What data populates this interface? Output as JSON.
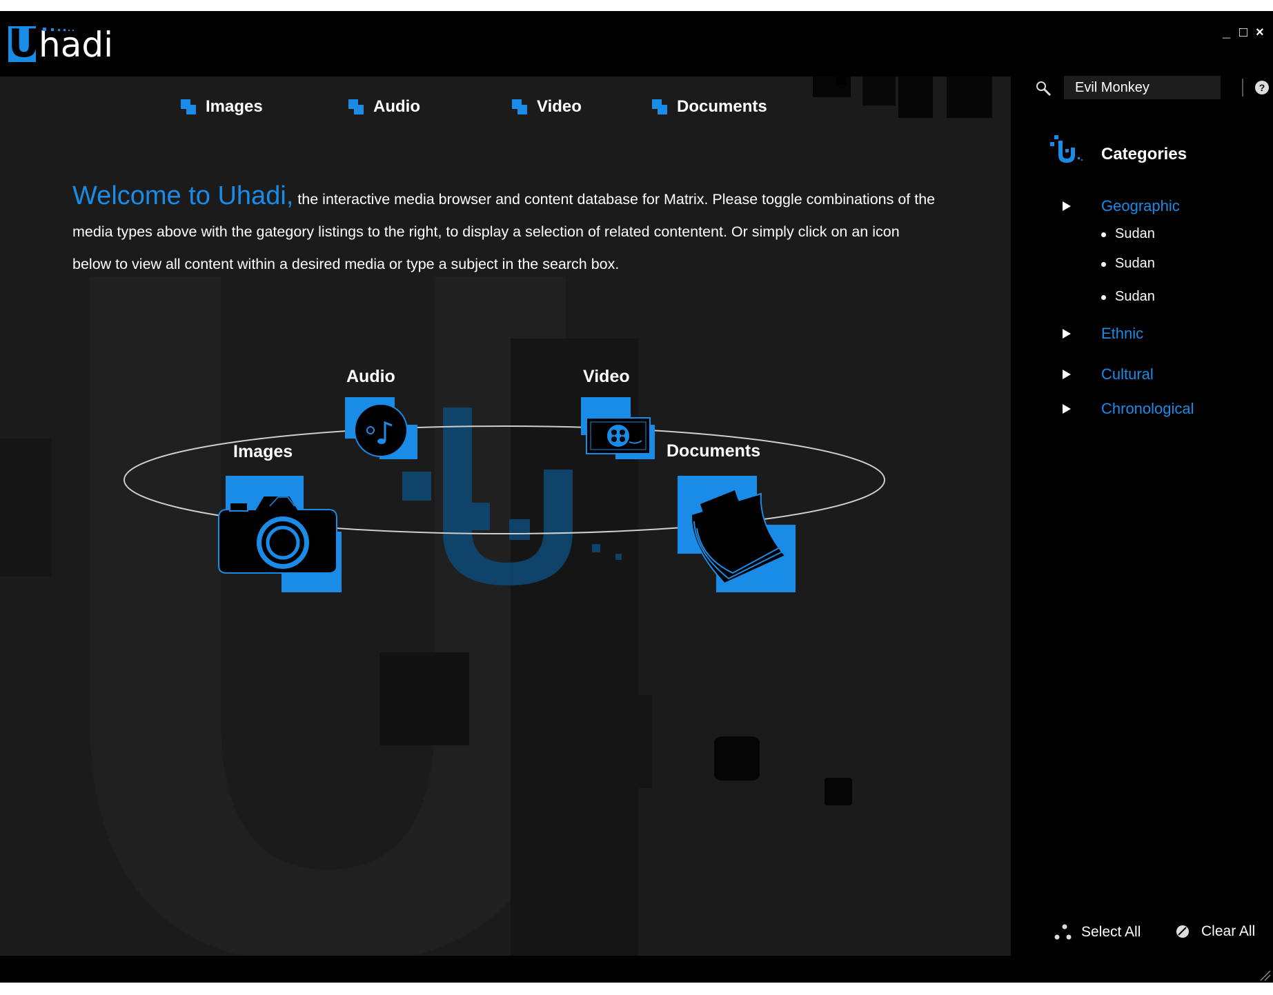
{
  "app": {
    "logo_letter": "U",
    "logo_rest": "hadi"
  },
  "window_controls": {
    "minimize": "_",
    "maximize": "□",
    "close": "×"
  },
  "nav_tabs": [
    {
      "label": "Images"
    },
    {
      "label": "Audio"
    },
    {
      "label": "Video"
    },
    {
      "label": "Documents"
    }
  ],
  "welcome": {
    "highlight": "Welcome to Uhadi,",
    "text": " the interactive media browser and content database for Matrix.  Please toggle combinations of the media types above with the gategory listings to the right, to display a selection of related contentent.  Or simply click on an icon below to view all content within a desired media or type a subject in the search box."
  },
  "hub": {
    "images_label": "Images",
    "audio_label": "Audio",
    "video_label": "Video",
    "documents_label": "Documents"
  },
  "search": {
    "value": "Evil Monkey",
    "icon": "search-icon",
    "help_icon": "help-icon"
  },
  "categories": {
    "title": "Categories",
    "items": [
      {
        "label": "Geographic",
        "expanded": true,
        "children": [
          "Sudan",
          "Sudan",
          "Sudan"
        ]
      },
      {
        "label": "Ethnic"
      },
      {
        "label": "Cultural"
      },
      {
        "label": "Chronological"
      }
    ]
  },
  "footer": {
    "select_all": "Select All",
    "clear_all": "Clear All"
  },
  "colors": {
    "accent": "#1a8be6",
    "panel": "#1b1b1b",
    "sidebar": "#000000"
  }
}
